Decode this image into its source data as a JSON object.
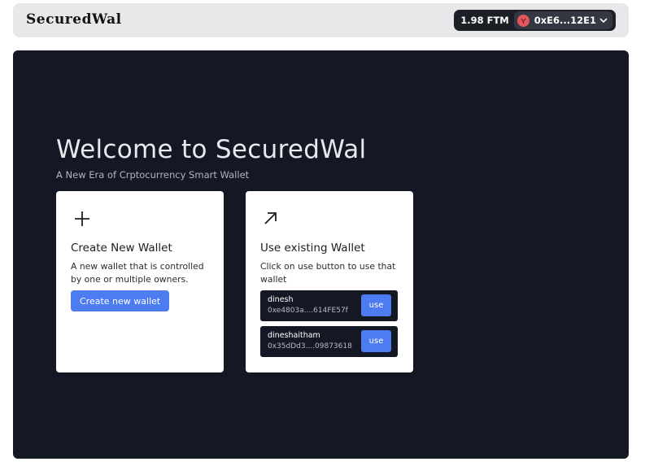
{
  "header": {
    "brand": "SecuredWal",
    "balance": "1.98 FTM",
    "address": "0xE6...12E1",
    "avatar_color": "#e2585d"
  },
  "main": {
    "title": "Welcome to SecuredWal",
    "subtitle": "A New Era of Crptocurrency Smart Wallet",
    "background": "#141824"
  },
  "create_card": {
    "icon": "plus-icon",
    "title": "Create New Wallet",
    "description": "A new wallet that is controlled by one or multiple owners.",
    "button_label": "Create new wallet"
  },
  "existing_card": {
    "icon": "arrow-up-right-icon",
    "title": "Use existing Wallet",
    "description": "Click on use button to use that wallet",
    "wallets": [
      {
        "name": "dinesh",
        "address": "0xe4803a....614FE57f",
        "button_label": "use"
      },
      {
        "name": "dineshaitham",
        "address": "0x35dDd3....09873618",
        "button_label": "use"
      }
    ]
  },
  "colors": {
    "accent": "#4d7bf0",
    "dark": "#141824"
  }
}
